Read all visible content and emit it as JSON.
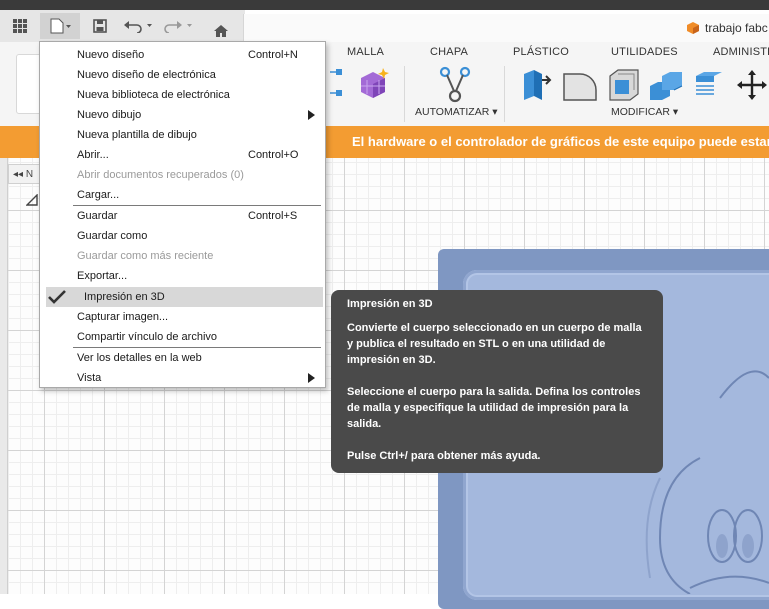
{
  "app": {
    "document_name": "trabajo fabc"
  },
  "quick_access": {
    "grid_icon": "app-grid-icon",
    "file_icon": "file-icon",
    "save_icon": "save-icon",
    "undo_icon": "undo-icon",
    "redo_icon": "redo-icon",
    "home_icon": "home-icon"
  },
  "toolbar": {
    "tabs": [
      "MALLA",
      "CHAPA",
      "PLÁSTICO",
      "UTILIDADES",
      "ADMINISTRAR"
    ],
    "groups": {
      "automatizar": "AUTOMATIZAR ▾",
      "modificar": "MODIFICAR ▾"
    }
  },
  "warning": {
    "text": "El hardware o el controlador de gráficos de este equipo puede estar"
  },
  "browser": {
    "collapse_label": "◂◂ N"
  },
  "file_menu": {
    "items": [
      {
        "label": "Nuevo diseño",
        "shortcut": "Control+N"
      },
      {
        "label": "Nuevo diseño de electrónica",
        "shortcut": ""
      },
      {
        "label": "Nueva biblioteca de electrónica",
        "shortcut": ""
      },
      {
        "label": "Nuevo dibujo",
        "shortcut": ""
      },
      {
        "label": "Nueva plantilla de dibujo",
        "shortcut": ""
      },
      {
        "label": "Abrir...",
        "shortcut": "Control+O"
      },
      {
        "label": "Abrir documentos recuperados (0)",
        "shortcut": ""
      },
      {
        "label": "Cargar...",
        "shortcut": ""
      },
      {
        "label": "Guardar",
        "shortcut": "Control+S"
      },
      {
        "label": "Guardar como",
        "shortcut": ""
      },
      {
        "label": "Guardar como más reciente",
        "shortcut": ""
      },
      {
        "label": "Exportar...",
        "shortcut": ""
      },
      {
        "label": "Impresión en 3D",
        "shortcut": ""
      },
      {
        "label": "Capturar imagen...",
        "shortcut": ""
      },
      {
        "label": "Compartir vínculo de archivo",
        "shortcut": ""
      },
      {
        "label": "Ver los detalles en la web",
        "shortcut": ""
      },
      {
        "label": "Vista",
        "shortcut": ""
      }
    ]
  },
  "tooltip": {
    "title": "Impresión en 3D",
    "p1": "Convierte el cuerpo seleccionado en un cuerpo de malla y publica el resultado en STL o en una utilidad de impresión en 3D.",
    "p2": "Seleccione el cuerpo para la salida. Defina los controles de malla y especifique la utilidad de impresión para la salida.",
    "p3": "Pulse Ctrl+/ para obtener más ayuda."
  },
  "colors": {
    "warning_bar": "#f39c32",
    "tooltip_bg": "#4a4a4a",
    "model_blue": "#a4b8dd",
    "menu_highlight": "#d8d8d8"
  }
}
